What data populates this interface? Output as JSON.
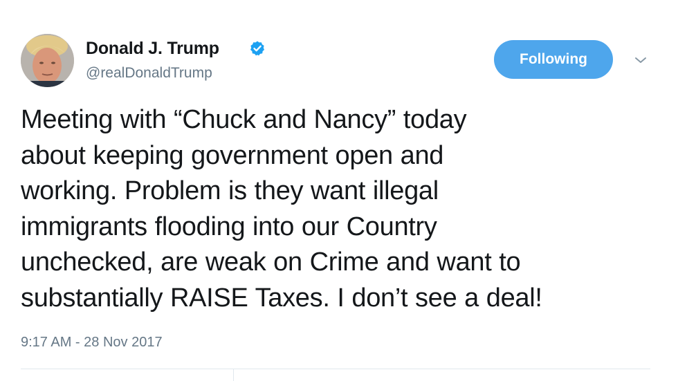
{
  "author": {
    "display_name": "Donald J. Trump",
    "handle": "@realDonaldTrump",
    "verified": true
  },
  "actions": {
    "follow_label": "Following",
    "follow_color": "#4ea6ec",
    "menu_icon": "chevron-down-icon"
  },
  "tweet": {
    "lines": [
      "Meeting with “Chuck and Nancy” today",
      "about keeping government open and",
      "working. Problem is they want illegal",
      "immigrants flooding into our Country",
      "unchecked, are weak on Crime and want to",
      "substantially RAISE Taxes. I don’t see a deal!"
    ],
    "timestamp": "9:17 AM - 28 Nov 2017"
  },
  "colors": {
    "text": "#14171a",
    "secondary": "#657786",
    "verified_badge": "#1da1f2",
    "divider": "#e1e8ed"
  }
}
